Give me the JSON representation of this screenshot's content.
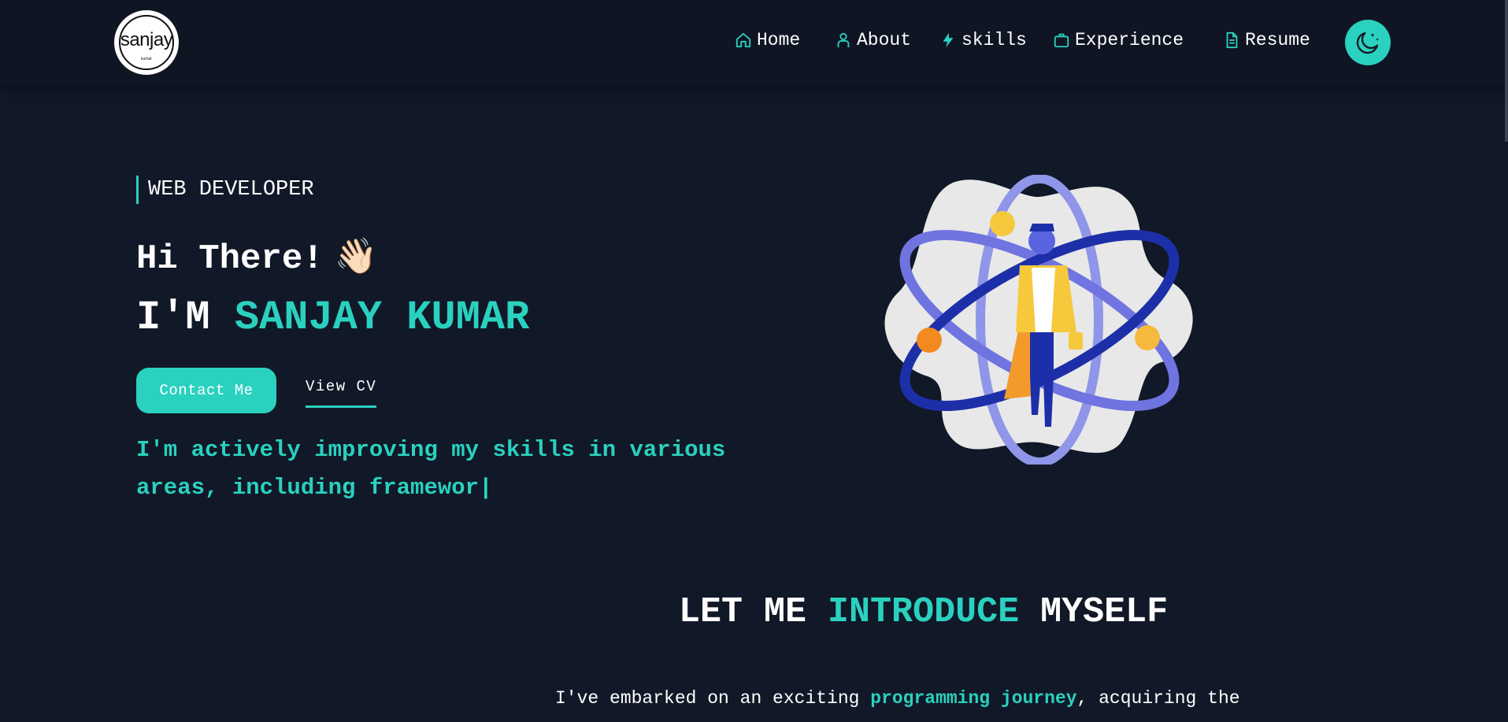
{
  "logo": {
    "text": "sanjay",
    "subtext": "kumar"
  },
  "nav": {
    "items": [
      {
        "label": "Home",
        "icon": "home-icon"
      },
      {
        "label": "About",
        "icon": "user-icon"
      },
      {
        "label": "skills",
        "icon": "lightning-icon"
      },
      {
        "label": "Experience",
        "icon": "briefcase-icon"
      },
      {
        "label": "Resume",
        "icon": "document-icon"
      }
    ],
    "theme_toggle_icon": "moon-icon"
  },
  "hero": {
    "role": "WEB DEVELOPER",
    "greeting": "Hi There!",
    "wave_emoji": "👋🏻",
    "name_prefix": "I'M",
    "name": "SANJAY KUMAR",
    "contact_button": "Contact Me",
    "cv_button": "View CV",
    "typing_text": "I'm actively improving my skills in various areas, including framewor|"
  },
  "intro": {
    "heading_part1": "LET ME",
    "heading_accent": "INTRODUCE",
    "heading_part2": "MYSELF",
    "text_part1": "I've embarked on an exciting ",
    "text_accent": "programming journey",
    "text_part2": ", acquiring the"
  },
  "colors": {
    "background": "#111827",
    "navbar": "#0f1523",
    "accent": "#2ad1bf",
    "text": "#ffffff"
  }
}
